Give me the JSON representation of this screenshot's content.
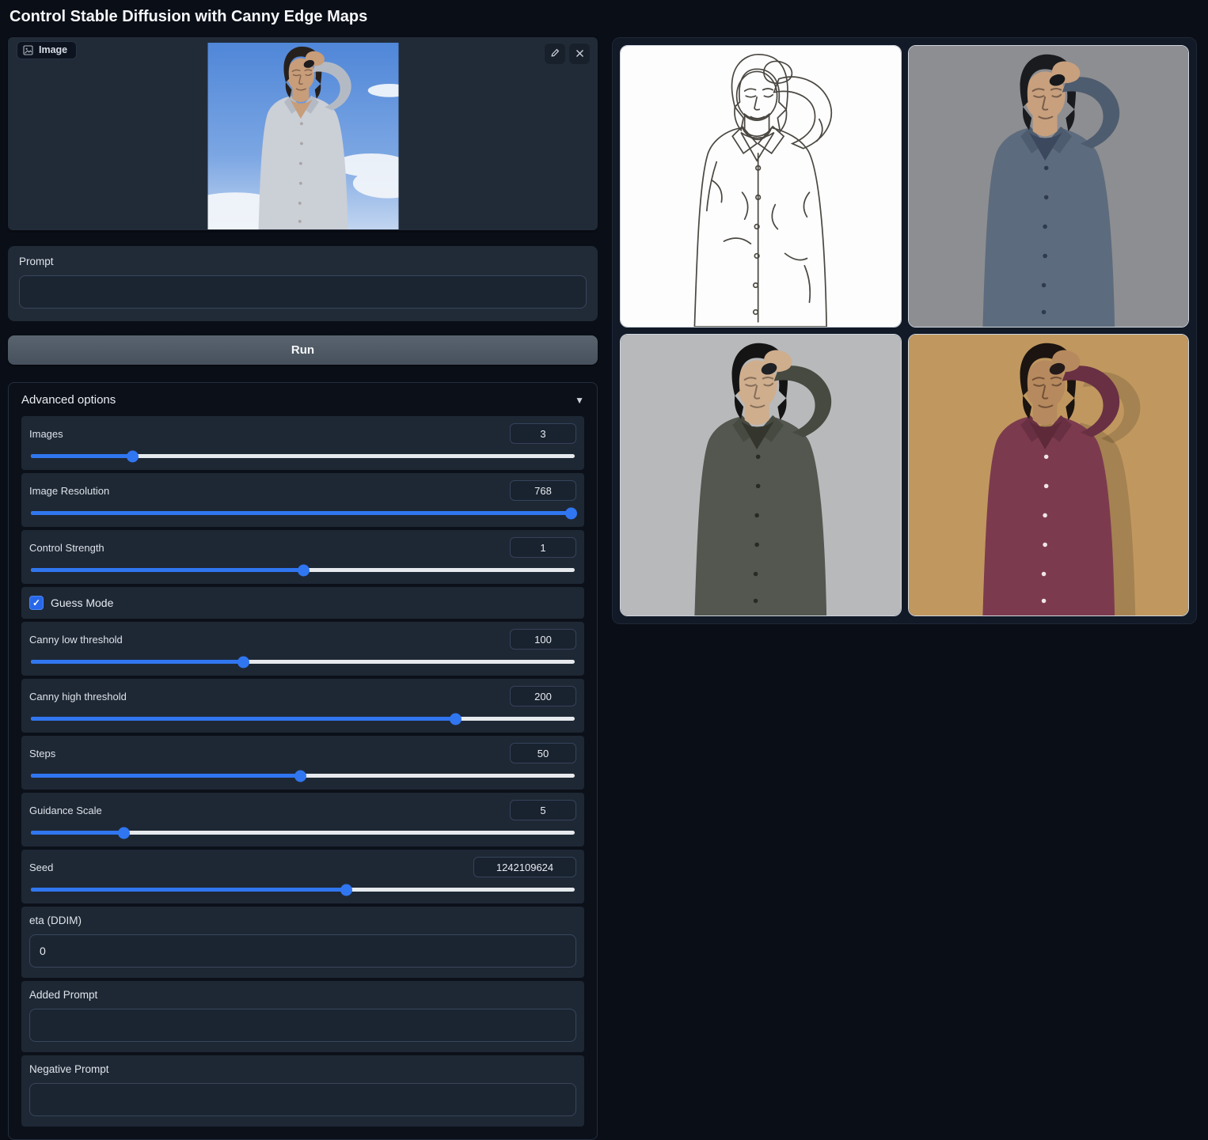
{
  "title": "Control Stable Diffusion with Canny Edge Maps",
  "icons": {
    "check": "✓",
    "collapse": "▼"
  },
  "input_image": {
    "label": "Image",
    "description": "man-in-light-shirt-hand-on-head-blue-sky",
    "palette": {
      "shirt": "#cbcfd6",
      "shirt2": "#b4bac4",
      "skin": "#c79d7a",
      "hair": "#26201d",
      "tee": "#c79d7a",
      "btn": "rgba(90,70,60,0.3)",
      "band": "#1d1c1e",
      "facestroke": "rgba(70,45,35,0.55)",
      "bg": "#5c8edb"
    }
  },
  "prompt": {
    "label": "Prompt",
    "value": ""
  },
  "run_label": "Run",
  "advanced": {
    "header": "Advanced options",
    "sliders": [
      {
        "label": "Images",
        "value": "3",
        "percent": 18.7
      },
      {
        "label": "Image Resolution",
        "value": "768",
        "percent": 99.3
      },
      {
        "label": "Control Strength",
        "value": "1",
        "percent": 50
      },
      {
        "label": "Canny low threshold",
        "value": "100",
        "percent": 39
      },
      {
        "label": "Canny high threshold",
        "value": "200",
        "percent": 78
      },
      {
        "label": "Steps",
        "value": "50",
        "percent": 49.5
      },
      {
        "label": "Guidance Scale",
        "value": "5",
        "percent": 17
      },
      {
        "label": "Seed",
        "value": "1242109624",
        "percent": 58
      }
    ],
    "guess_mode": {
      "label": "Guess Mode",
      "checked": true
    },
    "eta": {
      "label": "eta (DDIM)",
      "value": "0"
    },
    "added_prompt": {
      "label": "Added Prompt",
      "value": ""
    },
    "negative_prompt": {
      "label": "Negative Prompt",
      "value": ""
    }
  },
  "gallery": {
    "items": [
      {
        "name": "canny-edge-map",
        "palette": {
          "bg": "#fdfdfd",
          "line": "#4a4741"
        }
      },
      {
        "name": "generated-image-1",
        "palette": {
          "bg": "#8d8e91",
          "shirt": "#5d6b7e",
          "shirt2": "#4e5c6f",
          "skin": "#c8a07e",
          "hair": "#1a1b1f",
          "tee": "#3c485e",
          "btn": "#2f3a4e",
          "band": "#16181c",
          "facestroke": "rgba(55,40,32,0.55)"
        }
      },
      {
        "name": "generated-image-2",
        "palette": {
          "bg": "#b8b9bb",
          "shirt": "#53574f",
          "shirt2": "#464a41",
          "skin": "#cfae8e",
          "hair": "#141414",
          "tee": "#34362e",
          "btn": "#282a23",
          "band": "#1f2125",
          "facestroke": "rgba(60,45,35,0.5)"
        }
      },
      {
        "name": "generated-image-3",
        "palette": {
          "bg": "#c0985f",
          "shirt": "#7c3a4f",
          "shirt2": "#693043",
          "skin": "#b68a5e",
          "hair": "#1b1410",
          "tee": "#5e2939",
          "btn": "#efe6e6",
          "band": "#241a1a",
          "facestroke": "rgba(60,35,25,0.55)"
        }
      }
    ]
  },
  "theme": {
    "accent": "#3076f0",
    "page_bg": "#0a0e16",
    "block_bg": "#212b38",
    "row_bg": "#1e2835",
    "track_bg": "#e6e9ed",
    "sky_top": "#4f86d8",
    "sky_bottom": "#c3d6f0"
  }
}
